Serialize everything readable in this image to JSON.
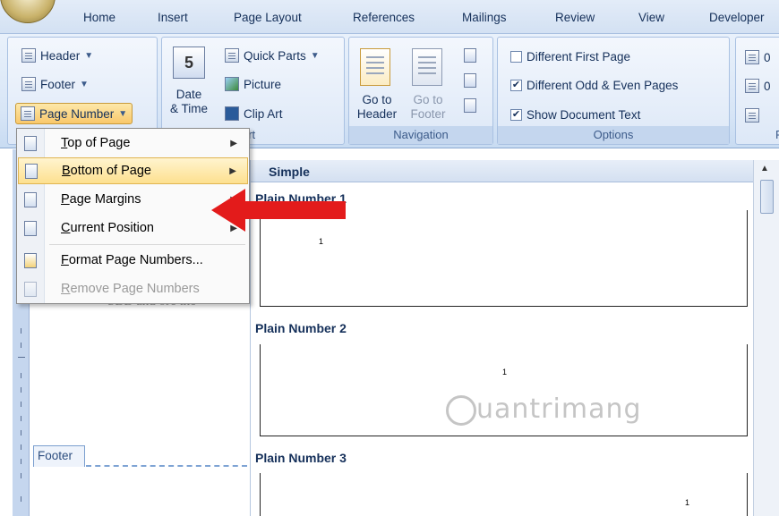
{
  "tabs": [
    "Home",
    "Insert",
    "Page Layout",
    "References",
    "Mailings",
    "Review",
    "View",
    "Developer"
  ],
  "ribbon": {
    "header_footer": {
      "header": "Header",
      "footer": "Footer",
      "page_number": "Page Number"
    },
    "insert_group": {
      "date_time_line1": "Date",
      "date_time_line2": "& Time",
      "quick_parts": "Quick Parts",
      "picture": "Picture",
      "clip_art": "Clip Art",
      "label_visible": "ert"
    },
    "navigation": {
      "go_header_line1": "Go to",
      "go_header_line2": "Header",
      "go_footer_line1": "Go to",
      "go_footer_line2": "Footer",
      "label": "Navigation"
    },
    "options": {
      "different_first_page": "Different First Page",
      "different_first_page_checked": false,
      "different_odd_even": "Different Odd & Even Pages",
      "different_odd_even_checked": true,
      "show_document_text": "Show Document Text",
      "show_document_text_checked": true,
      "label": "Options"
    },
    "position": {
      "top_value": "0",
      "bottom_value": "0",
      "label": "P"
    }
  },
  "menu": {
    "items": [
      {
        "label": "Top of Page",
        "underline": "T",
        "rest": "op of Page",
        "submenu": true
      },
      {
        "label": "Bottom of Page",
        "underline": "B",
        "rest": "ottom of Page",
        "submenu": true,
        "highlighted": true
      },
      {
        "label": "Page Margins",
        "underline": "P",
        "rest": "age Margins",
        "submenu": true
      },
      {
        "label": "Current Position",
        "underline": "C",
        "rest": "urrent Position",
        "submenu": true
      },
      {
        "label": "Format Page Numbers...",
        "underline": "F",
        "rest": "ormat Page Numbers..."
      },
      {
        "label": "Remove Page Numbers",
        "underline": "R",
        "rest": "emove Page Numbers",
        "disabled": true
      }
    ]
  },
  "gallery": {
    "section": "Simple",
    "items": [
      {
        "label": "Plain Number 1",
        "number": "1"
      },
      {
        "label": "Plain Number 2",
        "number": "1"
      },
      {
        "label": "Plain Number 3",
        "number": "1"
      }
    ]
  },
  "document": {
    "footer_tab": "Footer",
    "obscured_text": "SBB and ore the"
  },
  "watermark": "uantrimang",
  "colors": {
    "ribbon_bg": "#d7e5f6",
    "highlight": "#fde08f",
    "arrow": "#e31b1b"
  }
}
